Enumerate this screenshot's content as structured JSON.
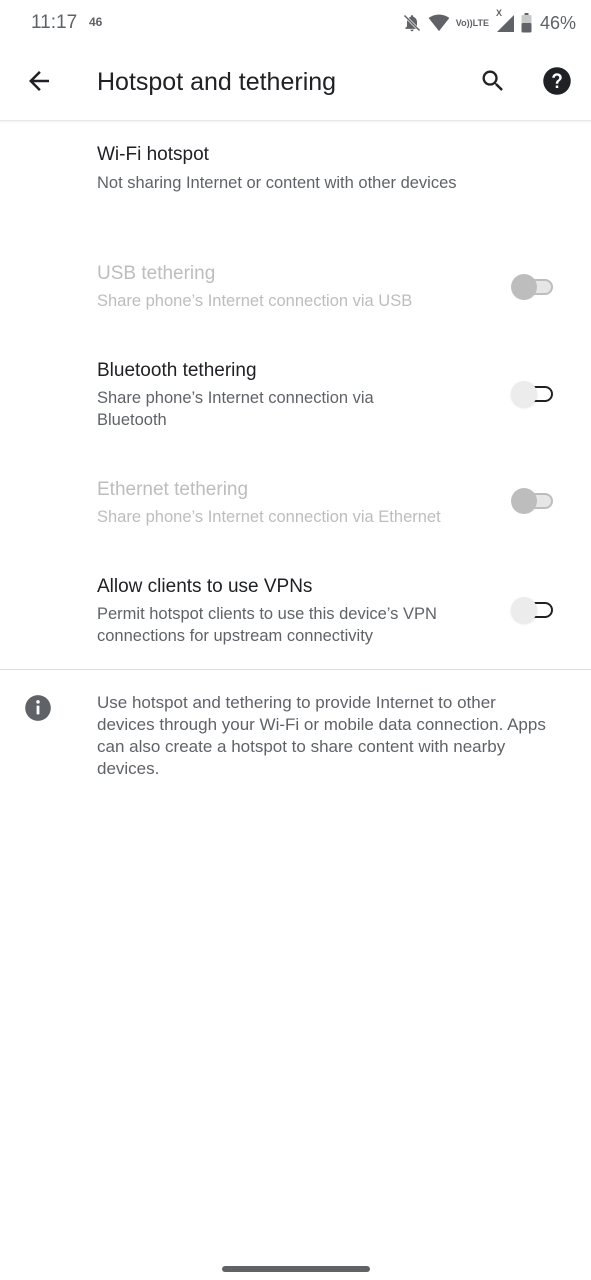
{
  "status_bar": {
    "time": "11:17",
    "network_badge": "46",
    "volte_line1": "Vo))",
    "volte_line2": "LTE",
    "no_signal_mark": "X",
    "battery_percent": "46%"
  },
  "app_bar": {
    "title": "Hotspot and tethering",
    "back_icon": "arrow-back-icon",
    "search_icon": "search-icon",
    "help_icon": "help-icon"
  },
  "items": [
    {
      "title": "Wi-Fi hotspot",
      "subtitle": "Not sharing Internet or content with other devices",
      "enabled": true,
      "has_toggle": false
    },
    {
      "title": "USB tethering",
      "subtitle": "Share phone’s Internet connection via USB",
      "enabled": false,
      "has_toggle": true,
      "checked": false
    },
    {
      "title": "Bluetooth tethering",
      "subtitle": "Share phone’s Internet connection via Bluetooth",
      "enabled": true,
      "has_toggle": true,
      "checked": false
    },
    {
      "title": "Ethernet tethering",
      "subtitle": "Share phone’s Internet connection via Ethernet",
      "enabled": false,
      "has_toggle": true,
      "checked": false
    },
    {
      "title": "Allow clients to use VPNs",
      "subtitle": "Permit hotspot clients to use this device’s VPN connections for upstream connectivity",
      "enabled": true,
      "has_toggle": true,
      "checked": false
    }
  ],
  "footer_info": {
    "icon": "info-icon",
    "text": "Use hotspot and tethering to provide Internet to other devices through your Wi-Fi or mobile data connection. Apps can also create a hotspot to share content with nearby devices."
  },
  "colors": {
    "text_primary": "#202124",
    "text_secondary": "#5f6368",
    "text_disabled": "#bdbdbd",
    "background": "#ffffff"
  }
}
